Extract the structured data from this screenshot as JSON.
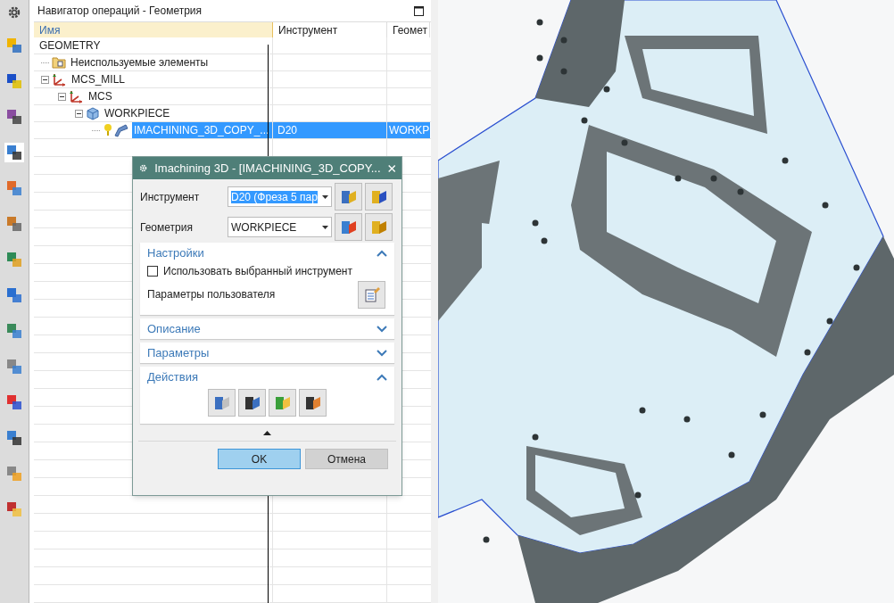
{
  "navigator": {
    "title": "Навигатор операций - Геометрия",
    "columns": [
      "Имя",
      "Инструмент",
      "Геомет"
    ],
    "tree": [
      {
        "name": "GEOMETRY",
        "selected": false,
        "children": [
          {
            "kind": "folder",
            "name": "Неиспользуемые элементы",
            "selected": false
          },
          {
            "kind": "mcs",
            "name": "MCS_MILL",
            "selected": false,
            "expanded": true,
            "children": [
              {
                "kind": "mcs",
                "name": "MCS",
                "selected": false,
                "expanded": true,
                "children": [
                  {
                    "kind": "workpiece",
                    "name": "WORKPIECE",
                    "selected": false,
                    "expanded": true,
                    "children": [
                      {
                        "kind": "operation",
                        "name": "IMACHINING_3D_COPY_...",
                        "tool": "D20",
                        "geometry": "WORKP",
                        "selected": true
                      }
                    ]
                  }
                ]
              }
            ]
          }
        ]
      }
    ]
  },
  "dialog": {
    "title": "Imachining 3D - [IMACHINING_3D_COPY...",
    "fields": [
      {
        "label": "Инструмент",
        "value": "D20 (Фреза 5 пар",
        "highlighted": true
      },
      {
        "label": "Геометрия",
        "value": "WORKPIECE",
        "highlighted": false
      }
    ],
    "sections": [
      {
        "kind": "settings",
        "title": "Настройки",
        "expanded": true,
        "checkbox": {
          "label": "Использовать выбранный инструмент",
          "checked": false
        },
        "user_params": "Параметры пользователя"
      },
      {
        "title": "Описание",
        "expanded": false
      },
      {
        "title": "Параметры",
        "expanded": false
      },
      {
        "kind": "actions",
        "title": "Действия",
        "expanded": true
      }
    ],
    "buttons": [
      {
        "label": "OK",
        "selected": true
      },
      {
        "label": "Отмена",
        "selected": false
      }
    ]
  }
}
